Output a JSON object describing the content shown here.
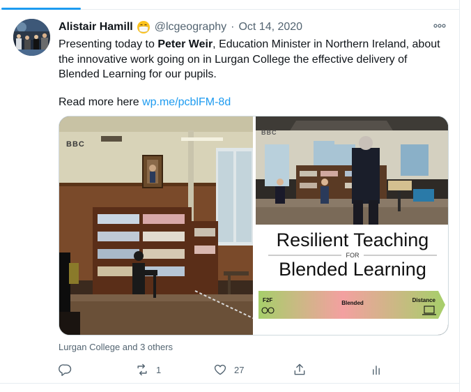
{
  "tweet": {
    "author_name": "Alistair Hamill",
    "emoji": "mask-face-emoji",
    "handle": "@lcgeography",
    "separator": "·",
    "date": "Oct 14, 2020",
    "text": {
      "part1": "Presenting today to ",
      "mention": "Peter Weir",
      "part2": ", Education Minister in Northern Ireland, about the innovative work going on in Lurgan College the effective delivery of Blended Learning for our pupils."
    },
    "read_more_label": "Read more here ",
    "link_text": "wp.me/pcblFM-8d"
  },
  "media": {
    "left_image": {
      "watermark": "BBC"
    },
    "right_image": {
      "watermark": "BBC",
      "graphic_title_line1": "Resilient Teaching",
      "graphic_for": "FOR",
      "graphic_title_line2": "Blended Learning",
      "bar_left_label": "F2F",
      "bar_middle_label": "Blended",
      "bar_right_label": "Distance"
    }
  },
  "tagged": "Lurgan College and 3 others",
  "actions": {
    "reply_count": "",
    "retweet_count": "1",
    "like_count": "27",
    "share_count": "",
    "analytics_count": ""
  },
  "colors": {
    "accent": "#1d9bf0",
    "text": "#0f1419",
    "secondary": "#536471",
    "border": "#e6ecf0"
  }
}
